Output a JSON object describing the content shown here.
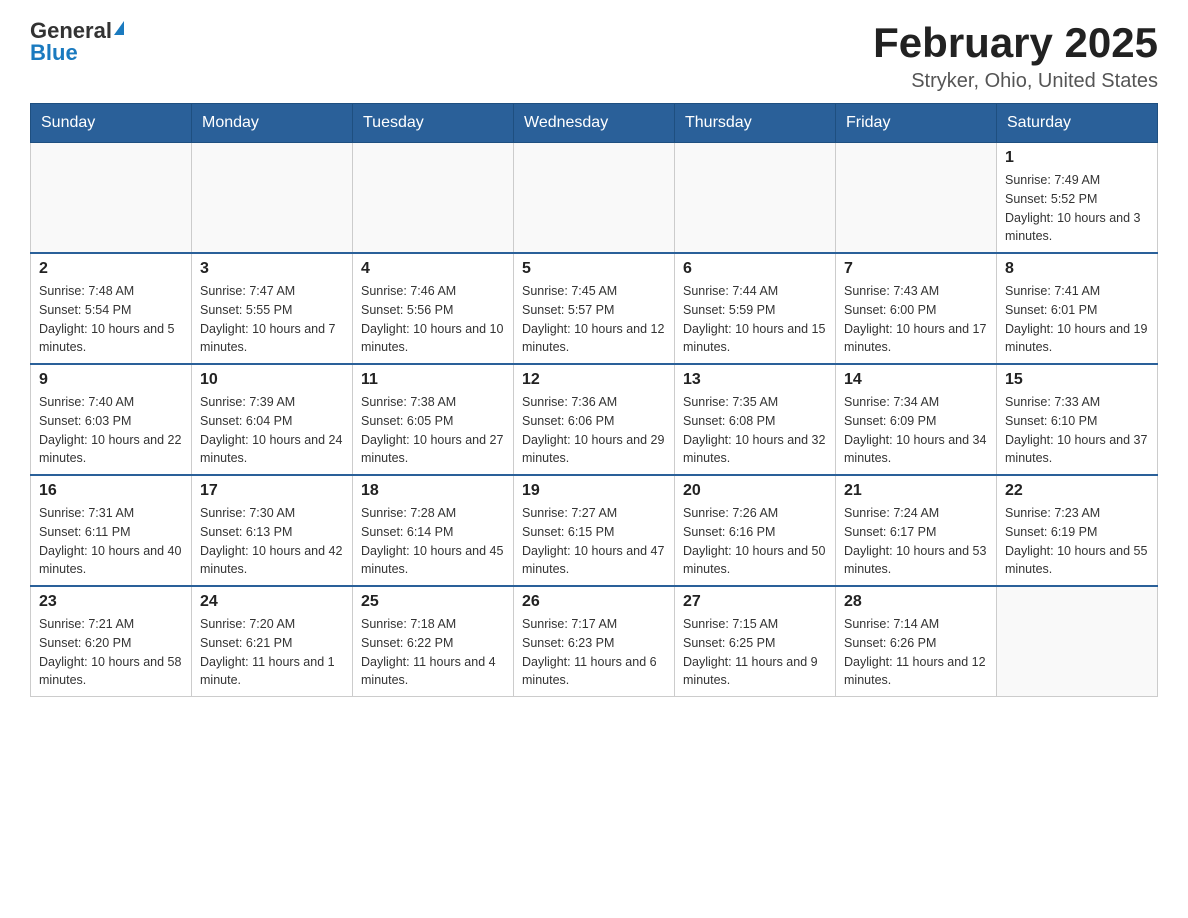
{
  "header": {
    "logo_general": "General",
    "logo_blue": "Blue",
    "month_title": "February 2025",
    "location": "Stryker, Ohio, United States"
  },
  "weekdays": [
    "Sunday",
    "Monday",
    "Tuesday",
    "Wednesday",
    "Thursday",
    "Friday",
    "Saturday"
  ],
  "weeks": [
    [
      {
        "day": "",
        "info": ""
      },
      {
        "day": "",
        "info": ""
      },
      {
        "day": "",
        "info": ""
      },
      {
        "day": "",
        "info": ""
      },
      {
        "day": "",
        "info": ""
      },
      {
        "day": "",
        "info": ""
      },
      {
        "day": "1",
        "info": "Sunrise: 7:49 AM\nSunset: 5:52 PM\nDaylight: 10 hours and 3 minutes."
      }
    ],
    [
      {
        "day": "2",
        "info": "Sunrise: 7:48 AM\nSunset: 5:54 PM\nDaylight: 10 hours and 5 minutes."
      },
      {
        "day": "3",
        "info": "Sunrise: 7:47 AM\nSunset: 5:55 PM\nDaylight: 10 hours and 7 minutes."
      },
      {
        "day": "4",
        "info": "Sunrise: 7:46 AM\nSunset: 5:56 PM\nDaylight: 10 hours and 10 minutes."
      },
      {
        "day": "5",
        "info": "Sunrise: 7:45 AM\nSunset: 5:57 PM\nDaylight: 10 hours and 12 minutes."
      },
      {
        "day": "6",
        "info": "Sunrise: 7:44 AM\nSunset: 5:59 PM\nDaylight: 10 hours and 15 minutes."
      },
      {
        "day": "7",
        "info": "Sunrise: 7:43 AM\nSunset: 6:00 PM\nDaylight: 10 hours and 17 minutes."
      },
      {
        "day": "8",
        "info": "Sunrise: 7:41 AM\nSunset: 6:01 PM\nDaylight: 10 hours and 19 minutes."
      }
    ],
    [
      {
        "day": "9",
        "info": "Sunrise: 7:40 AM\nSunset: 6:03 PM\nDaylight: 10 hours and 22 minutes."
      },
      {
        "day": "10",
        "info": "Sunrise: 7:39 AM\nSunset: 6:04 PM\nDaylight: 10 hours and 24 minutes."
      },
      {
        "day": "11",
        "info": "Sunrise: 7:38 AM\nSunset: 6:05 PM\nDaylight: 10 hours and 27 minutes."
      },
      {
        "day": "12",
        "info": "Sunrise: 7:36 AM\nSunset: 6:06 PM\nDaylight: 10 hours and 29 minutes."
      },
      {
        "day": "13",
        "info": "Sunrise: 7:35 AM\nSunset: 6:08 PM\nDaylight: 10 hours and 32 minutes."
      },
      {
        "day": "14",
        "info": "Sunrise: 7:34 AM\nSunset: 6:09 PM\nDaylight: 10 hours and 34 minutes."
      },
      {
        "day": "15",
        "info": "Sunrise: 7:33 AM\nSunset: 6:10 PM\nDaylight: 10 hours and 37 minutes."
      }
    ],
    [
      {
        "day": "16",
        "info": "Sunrise: 7:31 AM\nSunset: 6:11 PM\nDaylight: 10 hours and 40 minutes."
      },
      {
        "day": "17",
        "info": "Sunrise: 7:30 AM\nSunset: 6:13 PM\nDaylight: 10 hours and 42 minutes."
      },
      {
        "day": "18",
        "info": "Sunrise: 7:28 AM\nSunset: 6:14 PM\nDaylight: 10 hours and 45 minutes."
      },
      {
        "day": "19",
        "info": "Sunrise: 7:27 AM\nSunset: 6:15 PM\nDaylight: 10 hours and 47 minutes."
      },
      {
        "day": "20",
        "info": "Sunrise: 7:26 AM\nSunset: 6:16 PM\nDaylight: 10 hours and 50 minutes."
      },
      {
        "day": "21",
        "info": "Sunrise: 7:24 AM\nSunset: 6:17 PM\nDaylight: 10 hours and 53 minutes."
      },
      {
        "day": "22",
        "info": "Sunrise: 7:23 AM\nSunset: 6:19 PM\nDaylight: 10 hours and 55 minutes."
      }
    ],
    [
      {
        "day": "23",
        "info": "Sunrise: 7:21 AM\nSunset: 6:20 PM\nDaylight: 10 hours and 58 minutes."
      },
      {
        "day": "24",
        "info": "Sunrise: 7:20 AM\nSunset: 6:21 PM\nDaylight: 11 hours and 1 minute."
      },
      {
        "day": "25",
        "info": "Sunrise: 7:18 AM\nSunset: 6:22 PM\nDaylight: 11 hours and 4 minutes."
      },
      {
        "day": "26",
        "info": "Sunrise: 7:17 AM\nSunset: 6:23 PM\nDaylight: 11 hours and 6 minutes."
      },
      {
        "day": "27",
        "info": "Sunrise: 7:15 AM\nSunset: 6:25 PM\nDaylight: 11 hours and 9 minutes."
      },
      {
        "day": "28",
        "info": "Sunrise: 7:14 AM\nSunset: 6:26 PM\nDaylight: 11 hours and 12 minutes."
      },
      {
        "day": "",
        "info": ""
      }
    ]
  ]
}
